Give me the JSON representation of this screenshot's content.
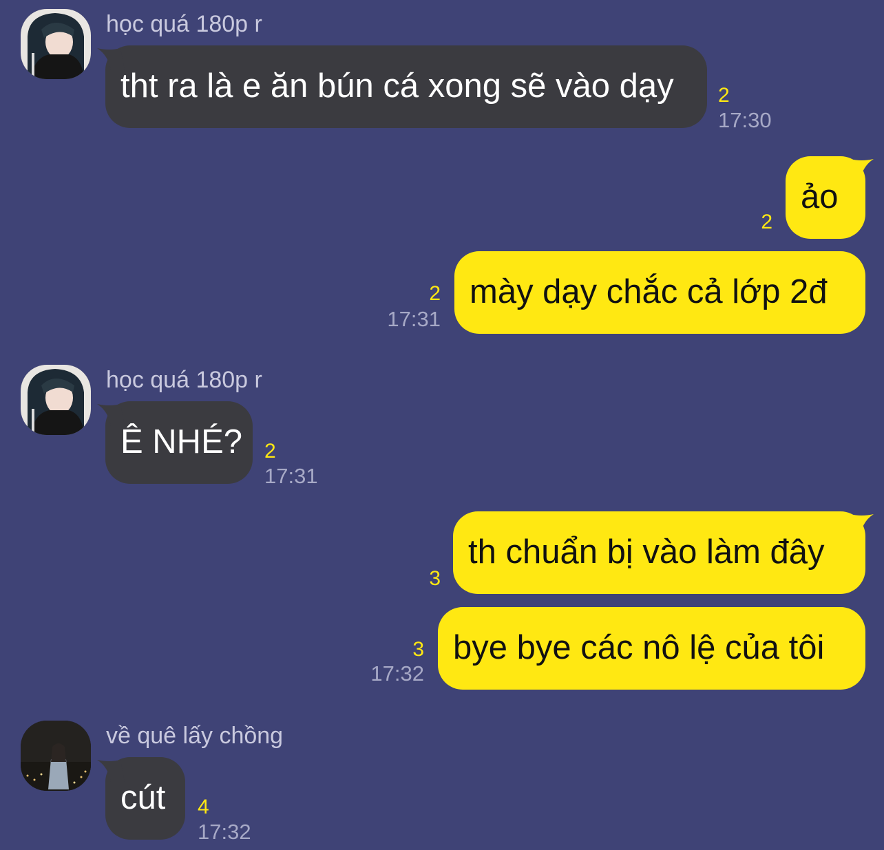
{
  "colors": {
    "background": "#3f4376",
    "incoming_bubble": "#3b3b40",
    "outgoing_bubble": "#ffe812",
    "unread_count": "#ffe812",
    "timestamp": "#a7a9c6",
    "sender_name": "#c9c9de"
  },
  "messages": [
    {
      "sender": "học quá 180p r",
      "text": "tht ra là e ăn bún cá xong sẽ vào dạy",
      "unread": "2",
      "time": "17:30"
    },
    {
      "text": "ảo",
      "unread": "2"
    },
    {
      "text": "mày dạy chắc cả lớp 2đ",
      "unread": "2",
      "time": "17:31"
    },
    {
      "sender": "học quá 180p r",
      "text": "Ê NHÉ?",
      "unread": "2",
      "time": "17:31"
    },
    {
      "text": "th chuẩn bị vào làm đây",
      "unread": "3"
    },
    {
      "text": "bye bye các nô lệ của tôi",
      "unread": "3",
      "time": "17:32"
    },
    {
      "sender": "về quê lấy chồng",
      "text": "cút",
      "unread": "4",
      "time": "17:32"
    }
  ],
  "avatars": [
    "avatar-girl-icon",
    "avatar-girl-icon",
    "avatar-city-night-icon"
  ]
}
